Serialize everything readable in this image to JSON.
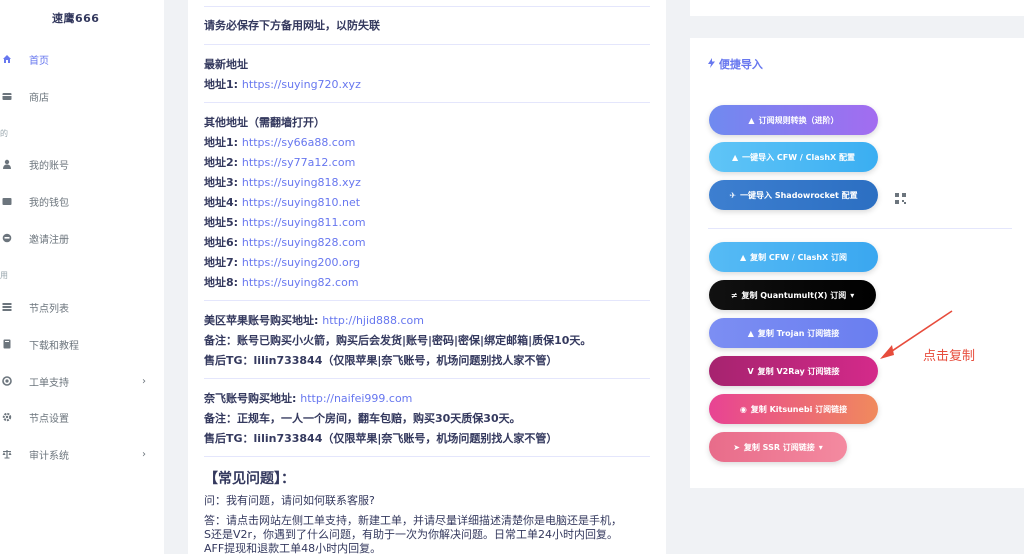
{
  "sidebar": {
    "brand": "速鹰666",
    "section_1": "的",
    "section_2": "用",
    "items": [
      {
        "label": "首页",
        "icon": "home-icon"
      },
      {
        "label": "商店",
        "icon": "store-icon"
      },
      {
        "label": "我的账号",
        "icon": "user-icon"
      },
      {
        "label": "我的钱包",
        "icon": "wallet-icon"
      },
      {
        "label": "邀请注册",
        "icon": "invite-icon"
      },
      {
        "label": "节点列表",
        "icon": "server-icon"
      },
      {
        "label": "下载和教程",
        "icon": "book-icon"
      },
      {
        "label": "工单支持",
        "icon": "support-icon"
      },
      {
        "label": "节点设置",
        "icon": "gear-icon"
      },
      {
        "label": "审计系统",
        "icon": "balance-icon"
      }
    ],
    "chevron": "›"
  },
  "main": {
    "notice": "请务必保存下方备用网址，以防失联",
    "latest_heading": "最新地址",
    "latest": {
      "label": "地址1:",
      "url": "https://suying720.xyz"
    },
    "other_heading": "其他地址（需翻墙打开）",
    "others": [
      {
        "label": "地址1:",
        "url": "https://sy66a88.com"
      },
      {
        "label": "地址2:",
        "url": "https://sy77a12.com"
      },
      {
        "label": "地址3:",
        "url": "https://suying818.xyz"
      },
      {
        "label": "地址4:",
        "url": "https://suying810.net"
      },
      {
        "label": "地址5:",
        "url": "https://suying811.com"
      },
      {
        "label": "地址6:",
        "url": "https://suying828.com"
      },
      {
        "label": "地址7:",
        "url": "https://suying200.org"
      },
      {
        "label": "地址8:",
        "url": "https://suying82.com"
      }
    ],
    "apple": {
      "label": "美区苹果账号购买地址:",
      "url": "http://hjid888.com",
      "note": "备注：账号已购买小火箭，购买后会发货|账号|密码|密保|绑定邮箱|质保10天。",
      "tg": "售后TG：lilin733844（仅限苹果|奈飞账号，机场问题别找人家不管）"
    },
    "netflix": {
      "label": "奈飞账号购买地址:",
      "url": "http://naifei999.com",
      "note": "备注：正规车，一人一个房间，翻车包赔，购买30天质保30天。",
      "tg": "售后TG：lilin733844（仅限苹果|奈飞账号，机场问题别找人家不管）"
    },
    "faq_title": "【常见问题】：",
    "faq_q": "问：我有问题，请问如何联系客服?",
    "faq_a1": "答：请点击网站左侧工单支持，新建工单，并请尽量详细描述清楚你是电脑还是手机，",
    "faq_a2": "S还是V2r，你遇到了什么问题，有助于一次为你解决问题。日常工单24小时内回复。",
    "faq_a3": "AFF提现和退款工单48小时内回复。"
  },
  "quick_import": {
    "title": "便捷导入",
    "title_icon": "bolt-icon",
    "buttons": [
      {
        "label": "订阅规则转换（进阶）",
        "icon": "▲",
        "color": "#a36cf0",
        "color2": "#6f8af0"
      },
      {
        "label": "一键导入 CFW / ClashX 配置",
        "icon": "▲",
        "color": "#3aaef2",
        "color2": "#60c5f7"
      },
      {
        "label": "一键导入 Shadowrocket 配置",
        "icon": "✈",
        "color": "#2c6fc2",
        "color2": "#3d7fd0"
      },
      {
        "label": "复制 CFW / ClashX 订阅",
        "icon": "▲",
        "color": "#3aa7f0",
        "color2": "#56bbf5"
      },
      {
        "label": "复制 Quantumult(X) 订阅",
        "icon": "≠",
        "color": "#000000",
        "color2": "#111111"
      },
      {
        "label": "复制 Trojan 订阅链接",
        "icon": "▲",
        "color": "#6a7ef0",
        "color2": "#7c8ef3"
      },
      {
        "label": "复制 V2Ray 订阅链接",
        "icon": "V",
        "color": "#d42a8a",
        "color2": "#a6236f"
      },
      {
        "label": "复制 Kitsunebi 订阅链接",
        "icon": "◉",
        "color": "#f08a5d",
        "color2": "#e84393"
      },
      {
        "label": "复制 SSR 订阅链接",
        "icon": "➤",
        "color": "#f48aa0",
        "color2": "#e86c8a"
      }
    ],
    "qr_icon": "qrcode-icon",
    "dropdown_caret": "▾"
  },
  "annotation": {
    "text": "点击复制",
    "color": "#e74c3c"
  }
}
